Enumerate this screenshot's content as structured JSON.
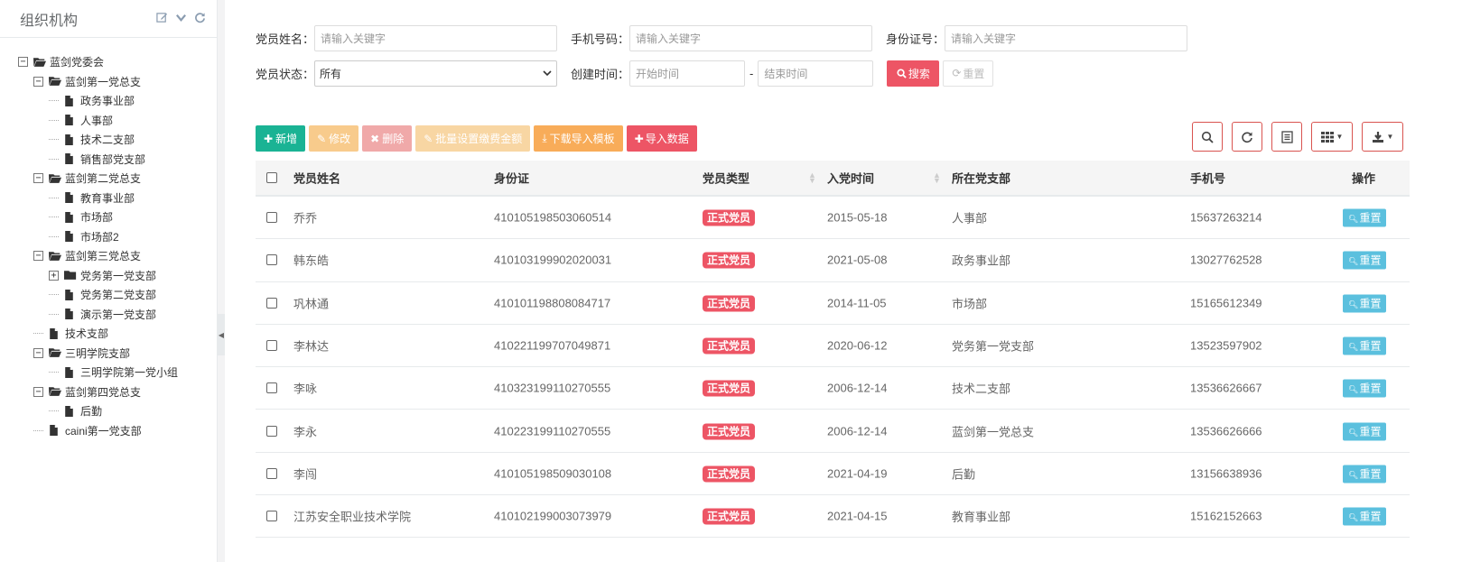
{
  "sidebar": {
    "title": "组织机构",
    "tree": [
      {
        "label": "蓝剑党委会",
        "depth": 0,
        "type": "folder-open",
        "toggle": "−"
      },
      {
        "label": "蓝剑第一党总支",
        "depth": 1,
        "type": "folder-open",
        "toggle": "−"
      },
      {
        "label": "政务事业部",
        "depth": 2,
        "type": "file",
        "toggle": ""
      },
      {
        "label": "人事部",
        "depth": 2,
        "type": "file",
        "toggle": ""
      },
      {
        "label": "技术二支部",
        "depth": 2,
        "type": "file",
        "toggle": ""
      },
      {
        "label": "销售部党支部",
        "depth": 2,
        "type": "file",
        "toggle": ""
      },
      {
        "label": "蓝剑第二党总支",
        "depth": 1,
        "type": "folder-open",
        "toggle": "−"
      },
      {
        "label": "教育事业部",
        "depth": 2,
        "type": "file",
        "toggle": ""
      },
      {
        "label": "市场部",
        "depth": 2,
        "type": "file",
        "toggle": ""
      },
      {
        "label": "市场部2",
        "depth": 2,
        "type": "file",
        "toggle": ""
      },
      {
        "label": "蓝剑第三党总支",
        "depth": 1,
        "type": "folder-open",
        "toggle": "−"
      },
      {
        "label": "党务第一党支部",
        "depth": 2,
        "type": "folder",
        "toggle": "+"
      },
      {
        "label": "党务第二党支部",
        "depth": 2,
        "type": "file",
        "toggle": ""
      },
      {
        "label": "演示第一党支部",
        "depth": 2,
        "type": "file",
        "toggle": ""
      },
      {
        "label": "技术支部",
        "depth": 1,
        "type": "file",
        "toggle": ""
      },
      {
        "label": "三明学院支部",
        "depth": 1,
        "type": "folder-open",
        "toggle": "−"
      },
      {
        "label": "三明学院第一党小组",
        "depth": 2,
        "type": "file",
        "toggle": ""
      },
      {
        "label": "蓝剑第四党总支",
        "depth": 1,
        "type": "folder-open",
        "toggle": "−"
      },
      {
        "label": "后勤",
        "depth": 2,
        "type": "file",
        "toggle": ""
      },
      {
        "label": "caini第一党支部",
        "depth": 1,
        "type": "file",
        "toggle": ""
      }
    ]
  },
  "search": {
    "name_label": "党员姓名：",
    "name_placeholder": "请输入关键字",
    "phone_label": "手机号码：",
    "phone_placeholder": "请输入关键字",
    "id_label": "身份证号：",
    "id_placeholder": "请输入关键字",
    "status_label": "党员状态：",
    "status_value": "所有",
    "created_label": "创建时间：",
    "start_placeholder": "开始时间",
    "dash": "-",
    "end_placeholder": "结束时间",
    "search_button": "搜索",
    "reset_button": "重置"
  },
  "toolbar": {
    "add": "新增",
    "edit": "修改",
    "delete": "删除",
    "batch": "批量设置缴费金额",
    "download": "下载导入模板",
    "import": "导入数据"
  },
  "colors": {
    "add": "#1ab394",
    "edit": "#f8cb8c",
    "delete": "#f0a9a9",
    "batch": "#f8d6a3",
    "download": "#f8ac59",
    "import": "#ed5565",
    "badge": "#ed5565",
    "reset": "#5bc0de"
  },
  "table": {
    "headers": {
      "name": "党员姓名",
      "id": "身份证",
      "type": "党员类型",
      "join": "入党时间",
      "branch": "所在党支部",
      "phone": "手机号",
      "action": "操作"
    },
    "rows": [
      {
        "name": "乔乔",
        "id": "410105198503060514",
        "type": "正式党员",
        "join": "2015-05-18",
        "branch": "人事部",
        "phone": "15637263214",
        "action": "重置"
      },
      {
        "name": "韩东皓",
        "id": "410103199902020031",
        "type": "正式党员",
        "join": "2021-05-08",
        "branch": "政务事业部",
        "phone": "13027762528",
        "action": "重置"
      },
      {
        "name": "巩林通",
        "id": "410101198808084717",
        "type": "正式党员",
        "join": "2014-11-05",
        "branch": "市场部",
        "phone": "15165612349",
        "action": "重置"
      },
      {
        "name": "李林达",
        "id": "410221199707049871",
        "type": "正式党员",
        "join": "2020-06-12",
        "branch": "党务第一党支部",
        "phone": "13523597902",
        "action": "重置"
      },
      {
        "name": "李咏",
        "id": "410323199110270555",
        "type": "正式党员",
        "join": "2006-12-14",
        "branch": "技术二支部",
        "phone": "13536626667",
        "action": "重置"
      },
      {
        "name": "李永",
        "id": "410223199110270555",
        "type": "正式党员",
        "join": "2006-12-14",
        "branch": "蓝剑第一党总支",
        "phone": "13536626666",
        "action": "重置"
      },
      {
        "name": "李闯",
        "id": "410105198509030108",
        "type": "正式党员",
        "join": "2021-04-19",
        "branch": "后勤",
        "phone": "13156638936",
        "action": "重置"
      },
      {
        "name": "江苏安全职业技术学院",
        "id": "410102199003073979",
        "type": "正式党员",
        "join": "2021-04-15",
        "branch": "教育事业部",
        "phone": "15162152663",
        "action": "重置"
      }
    ]
  }
}
